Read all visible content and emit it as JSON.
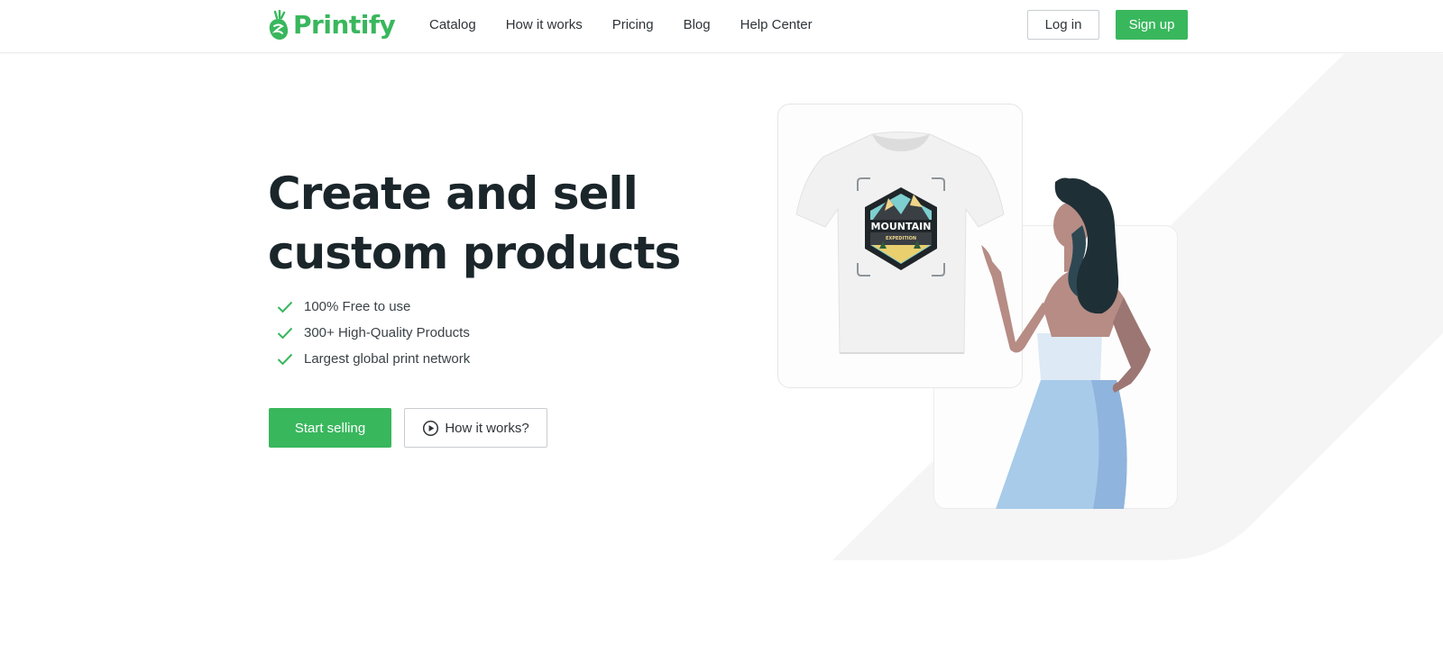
{
  "brand": {
    "name": "Printify",
    "color": "#39b75d",
    "logo_icon": "pineapple-logo-icon"
  },
  "nav": {
    "items": [
      {
        "label": "Catalog"
      },
      {
        "label": "How it works"
      },
      {
        "label": "Pricing"
      },
      {
        "label": "Blog"
      },
      {
        "label": "Help Center"
      }
    ]
  },
  "auth": {
    "login_label": "Log in",
    "signup_label": "Sign up"
  },
  "hero": {
    "title_line1": "Create and sell",
    "title_line2": "custom products",
    "features": [
      {
        "text": "100% Free to use",
        "icon": "check-icon"
      },
      {
        "text": "300+ High-Quality Products",
        "icon": "check-icon"
      },
      {
        "text": "Largest global print network",
        "icon": "check-icon"
      }
    ],
    "primary_cta": "Start selling",
    "secondary_cta": "How it works?",
    "secondary_cta_icon": "play-circle-icon"
  },
  "illustration": {
    "badge_title": "MOUNTAIN",
    "badge_subtitle": "EXPEDITION"
  }
}
